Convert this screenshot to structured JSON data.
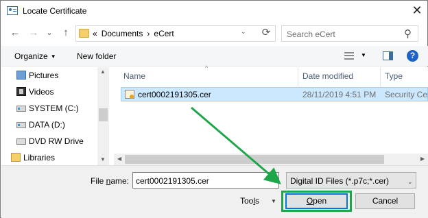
{
  "window": {
    "title": "Locate Certificate",
    "close_glyph": "✕"
  },
  "nav": {
    "back_glyph": "←",
    "forward_glyph": "→",
    "dropdown_glyph": "⌄",
    "up_glyph": "↑",
    "refresh_glyph": "⟳"
  },
  "address": {
    "overflow": "«",
    "path": [
      "Documents",
      "eCert"
    ],
    "separator": "›",
    "caret": "⌄"
  },
  "search": {
    "placeholder": "Search eCert",
    "icon_glyph": "⚲"
  },
  "toolbar": {
    "organize": "Organize",
    "new_folder": "New folder",
    "caret": "▼",
    "help": "?"
  },
  "sidebar": {
    "items": [
      {
        "label": "Pictures",
        "icon": "pictures-icon"
      },
      {
        "label": "Videos",
        "icon": "videos-icon"
      },
      {
        "label": "SYSTEM (C:)",
        "icon": "drive-icon"
      },
      {
        "label": "DATA (D:)",
        "icon": "drive-icon"
      },
      {
        "label": "DVD RW Drive",
        "icon": "dvd-icon"
      },
      {
        "label": "Libraries",
        "icon": "libraries-icon"
      }
    ]
  },
  "filelist": {
    "columns": [
      "Name",
      "Date modified",
      "Type"
    ],
    "sort_glyph": "^",
    "rows": [
      {
        "name": "cert0002191305.cer",
        "date": "28/11/2019 4:51 PM",
        "type": "Security Certificate",
        "selected": true
      }
    ]
  },
  "footer": {
    "file_name_label_pre": "File ",
    "file_name_label_u": "n",
    "file_name_label_post": "ame:",
    "file_name_value": "cert0002191305.cer",
    "filter_value": "Digital ID Files (*.p7c;*.cer)",
    "tools_pre": "Too",
    "tools_u": "l",
    "tools_post": "s",
    "open_pre": "",
    "open_u": "O",
    "open_post": "pen",
    "cancel": "Cancel"
  },
  "colors": {
    "selection": "#cce8ff",
    "highlight": "#1fa64a",
    "accent": "#0078d7"
  }
}
